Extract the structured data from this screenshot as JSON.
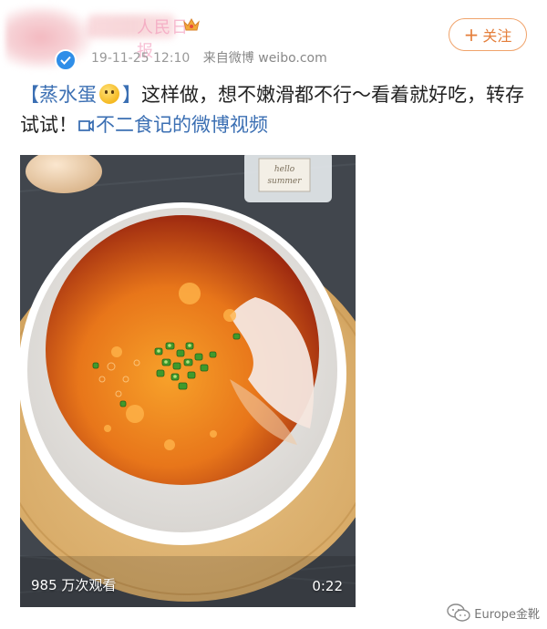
{
  "header": {
    "username": "人民日报",
    "timestamp": "19-11-25 12:10",
    "source": "来自微博 weibo.com",
    "follow_label": "关注",
    "follow_plus": "+"
  },
  "post": {
    "hashtag": "【蒸水蛋",
    "hashtag_close": "】",
    "body": "这样做，想不嫩滑都不行～看着就好吃，转存试试！",
    "video_link": "不二食记的微博视频"
  },
  "video": {
    "views": "985 万次观看",
    "duration": "0:22",
    "jar_label_line1": "hello",
    "jar_label_line2": "summer"
  },
  "watermark": {
    "text": "Europe金靴"
  },
  "colors": {
    "accent_orange": "#e47e3a",
    "link_blue": "#3b6fb3",
    "verify_blue": "#2f8ee8"
  }
}
